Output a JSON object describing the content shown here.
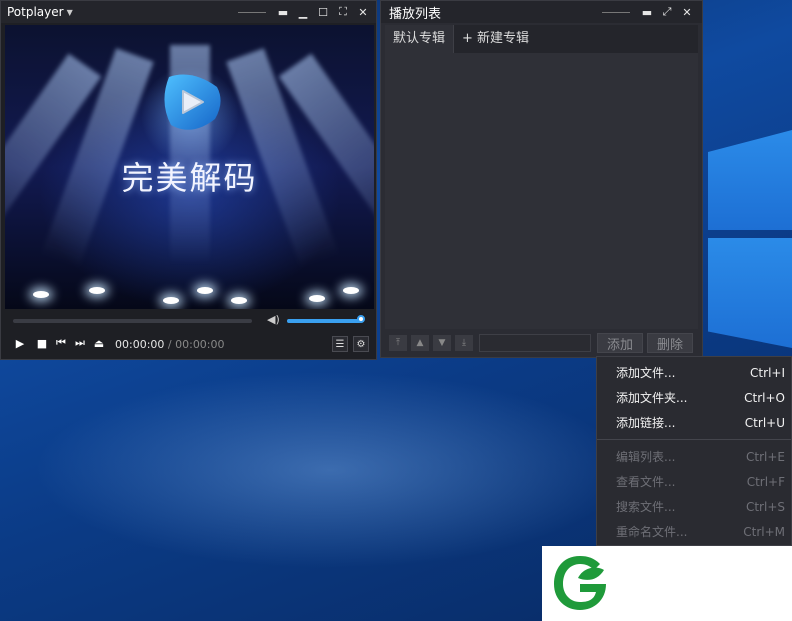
{
  "player": {
    "title": "Potplayer",
    "brand_text": "完美解码",
    "time_current": "00:00:00",
    "time_separator": " / ",
    "time_total": "00:00:00",
    "volume_level": 1.0
  },
  "playlist": {
    "title": "播放列表",
    "tabs": [
      {
        "label": "默认专辑"
      },
      {
        "label": "+ 新建专辑"
      }
    ],
    "add_label": "添加",
    "delete_label": "删除"
  },
  "context_menu": {
    "items": [
      {
        "label": "添加文件...",
        "shortcut": "Ctrl+I",
        "enabled": true
      },
      {
        "label": "添加文件夹...",
        "shortcut": "Ctrl+O",
        "enabled": true
      },
      {
        "label": "添加链接...",
        "shortcut": "Ctrl+U",
        "enabled": true
      },
      {
        "label": "编辑列表...",
        "shortcut": "Ctrl+E",
        "enabled": false
      },
      {
        "label": "查看文件...",
        "shortcut": "Ctrl+F",
        "enabled": false
      },
      {
        "label": "搜索文件...",
        "shortcut": "Ctrl+S",
        "enabled": false
      },
      {
        "label": "重命名文件...",
        "shortcut": "Ctrl+M",
        "enabled": false
      }
    ]
  },
  "icons": {
    "play": "play-icon",
    "stop": "stop-icon",
    "prev": "previous-icon",
    "next": "next-icon",
    "eject": "eject-icon",
    "volume": "volume-icon",
    "playlist": "playlist-icon",
    "settings": "gear-icon"
  },
  "colors": {
    "accent": "#3aa0f0",
    "window_bg": "#2b2c33",
    "watermark_green": "#1f9a3a"
  }
}
